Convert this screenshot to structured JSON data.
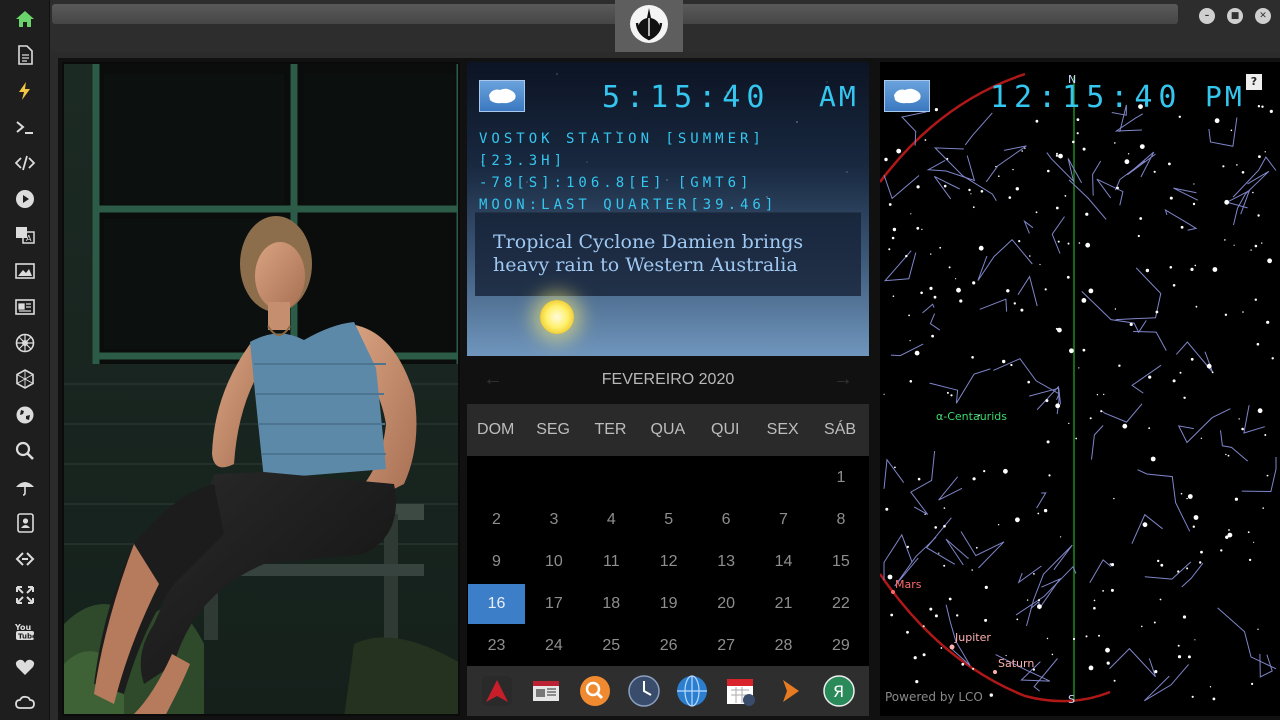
{
  "topbar": {
    "emblem_icon": "rebel-alliance-icon",
    "buttons": [
      "minimize-icon",
      "maximize-icon",
      "close-icon"
    ]
  },
  "sidebar": {
    "items": [
      {
        "name": "home",
        "icon": "home-icon",
        "active": true
      },
      {
        "name": "document",
        "icon": "document-icon"
      },
      {
        "name": "power",
        "icon": "lightning-icon"
      },
      {
        "name": "terminal",
        "icon": "terminal-icon"
      },
      {
        "name": "code",
        "icon": "code-icon"
      },
      {
        "name": "play",
        "icon": "play-icon"
      },
      {
        "name": "translate",
        "icon": "translate-icon"
      },
      {
        "name": "image",
        "icon": "image-icon"
      },
      {
        "name": "news",
        "icon": "newspaper-icon"
      },
      {
        "name": "empire",
        "icon": "galactic-empire-icon"
      },
      {
        "name": "hexagon",
        "icon": "hexagon-icon"
      },
      {
        "name": "globe",
        "icon": "globe-icon"
      },
      {
        "name": "search",
        "icon": "search-icon"
      },
      {
        "name": "weather",
        "icon": "umbrella-icon"
      },
      {
        "name": "contacts",
        "icon": "contacts-icon"
      },
      {
        "name": "links",
        "icon": "link-icon"
      },
      {
        "name": "fullscreen",
        "icon": "expand-icon"
      },
      {
        "name": "youtube",
        "icon": "youtube-icon"
      },
      {
        "name": "favorites",
        "icon": "heart-icon"
      },
      {
        "name": "cloud",
        "icon": "cloud-icon"
      }
    ]
  },
  "photo": {
    "icon": "photo-of-woman"
  },
  "clock_local": {
    "flag_icon": "antarctica-flag-icon",
    "time": "5:15:40",
    "ampm": "AM",
    "station": "VOSTOK STATION [SUMMER]",
    "hours": "[23.3H]",
    "coords": "-78[S]:106.8[E] [GMT6]",
    "moon": "MOON:LAST QUARTER[39.46]",
    "news": "Tropical Cyclone Damien brings heavy rain to Western Australia"
  },
  "calendar": {
    "month": "FEVEREIRO 2020",
    "prev_icon": "arrow-left-icon",
    "next_icon": "arrow-right-icon",
    "weekdays": [
      "DOM",
      "SEG",
      "TER",
      "QUA",
      "QUI",
      "SEX",
      "SÁB"
    ],
    "days": [
      "1",
      "2",
      "3",
      "4",
      "5",
      "6",
      "7",
      "8",
      "9",
      "10",
      "11",
      "12",
      "13",
      "14",
      "15",
      "16",
      "17",
      "18",
      "19",
      "20",
      "21",
      "22",
      "23",
      "24",
      "25",
      "26",
      "27",
      "28",
      "29"
    ],
    "first_weekday_index": 6,
    "today": "16"
  },
  "dock": {
    "items": [
      {
        "name": "app-launcher",
        "icon": "red-arrow-icon",
        "color": "#c81e2a"
      },
      {
        "name": "news-reader",
        "icon": "newspaper-icon",
        "color": "#e0e0e0"
      },
      {
        "name": "search",
        "icon": "magnifier-icon",
        "color": "#f08a30"
      },
      {
        "name": "clock",
        "icon": "clock-icon",
        "color": "#3a4c6c"
      },
      {
        "name": "browser",
        "icon": "globe-icon",
        "color": "#2c7fcf"
      },
      {
        "name": "calendar",
        "icon": "calendar-icon",
        "color": "#d8232a"
      },
      {
        "name": "media",
        "icon": "play-arrow-icon",
        "color": "#e87a22"
      },
      {
        "name": "yandex",
        "icon": "yandex-icon",
        "color": "#2a8a5a"
      }
    ]
  },
  "sky": {
    "flag_icon": "antarctica-flag-icon",
    "time": "12:15:40",
    "ampm": "PM",
    "help": "?",
    "north": "N",
    "south": "S",
    "labels": {
      "centaurids": "α-Centaurids",
      "mars": "Mars",
      "jupiter": "Jupiter",
      "saturn": "Saturn"
    },
    "powered_by": "Powered by LCO",
    "colors": {
      "meteor": "#3bd96b",
      "planet": "#ff6a6a",
      "ecliptic": "#b01818",
      "meridian": "#1e8a1e"
    }
  }
}
